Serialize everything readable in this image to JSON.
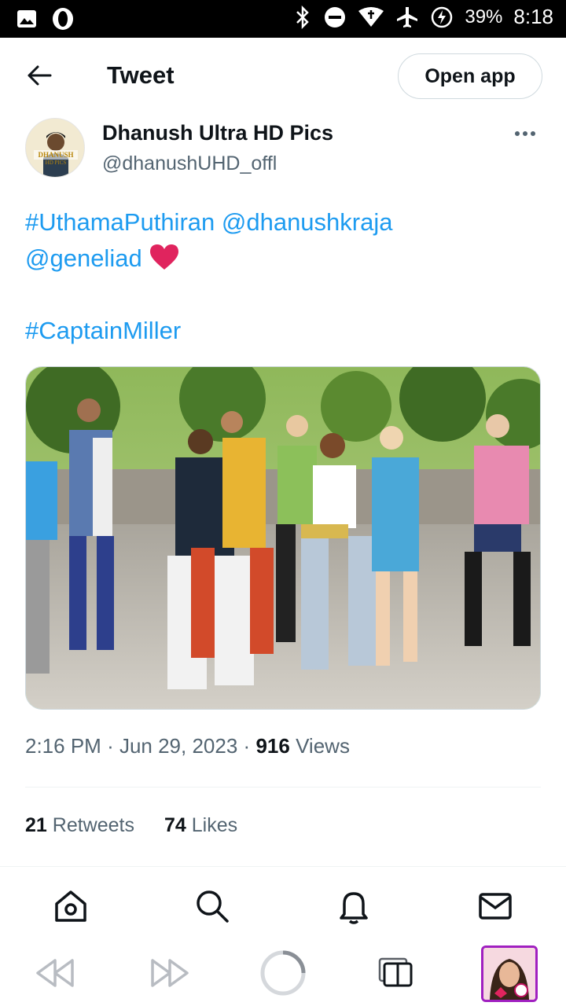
{
  "status_bar": {
    "battery": "39%",
    "time": "8:18"
  },
  "header": {
    "title": "Tweet",
    "open_app_label": "Open app"
  },
  "author": {
    "display_name": "Dhanush Ultra HD Pics",
    "handle": "@dhanushUHD_offl",
    "avatar_text_line1": "DHANUSH",
    "avatar_text_line2": "HD PICS"
  },
  "tweet": {
    "hashtag1": "#UthamaPuthiran",
    "mention1": "@dhanushkraja",
    "mention2": "@geneliad",
    "hashtag2": "#CaptainMiller"
  },
  "meta": {
    "time": "2:16 PM",
    "date": "Jun 29, 2023",
    "views_count": "916",
    "views_label": "Views"
  },
  "stats": {
    "retweets_count": "21",
    "retweets_label": "Retweets",
    "likes_count": "74",
    "likes_label": "Likes"
  },
  "icons": {
    "bottom_nav": [
      "home-icon",
      "search-icon",
      "notifications-bell-icon",
      "messages-envelope-icon"
    ],
    "browser_bar": [
      "back-icon",
      "forward-icon",
      "reload-icon",
      "tabs-icon",
      "opera-profile-thumbnail"
    ]
  },
  "colors": {
    "link": "#1d9bf0",
    "secondary_text": "#536471",
    "heart": "#e0245e",
    "thumbnail_border": "#a020c0"
  }
}
